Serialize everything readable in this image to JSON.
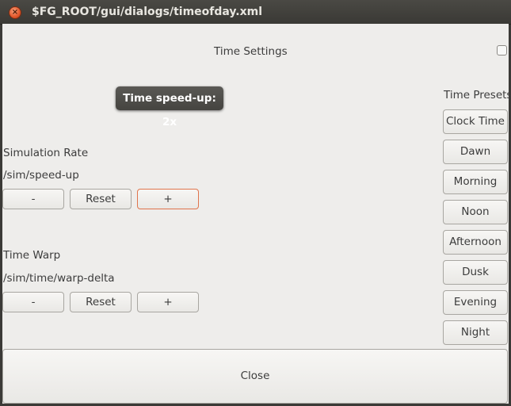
{
  "window": {
    "title": "$FG_ROOT/gui/dialogs/timeofday.xml",
    "close_icon": "close-icon"
  },
  "dialog": {
    "heading": "Time Settings",
    "tooltip": "Time speed-up: 2x",
    "simulation_rate": {
      "label": "Simulation Rate",
      "property": "/sim/speed-up",
      "minus_label": "-",
      "reset_label": "Reset",
      "plus_label": "+"
    },
    "time_warp": {
      "label": "Time Warp",
      "property": "/sim/time/warp-delta",
      "minus_label": "-",
      "reset_label": "Reset",
      "plus_label": "+"
    },
    "presets": {
      "label": "Time Presets",
      "items": [
        "Clock Time",
        "Dawn",
        "Morning",
        "Noon",
        "Afternoon",
        "Dusk",
        "Evening",
        "Night"
      ]
    },
    "close_label": "Close",
    "accent_color": "#e0744c"
  }
}
